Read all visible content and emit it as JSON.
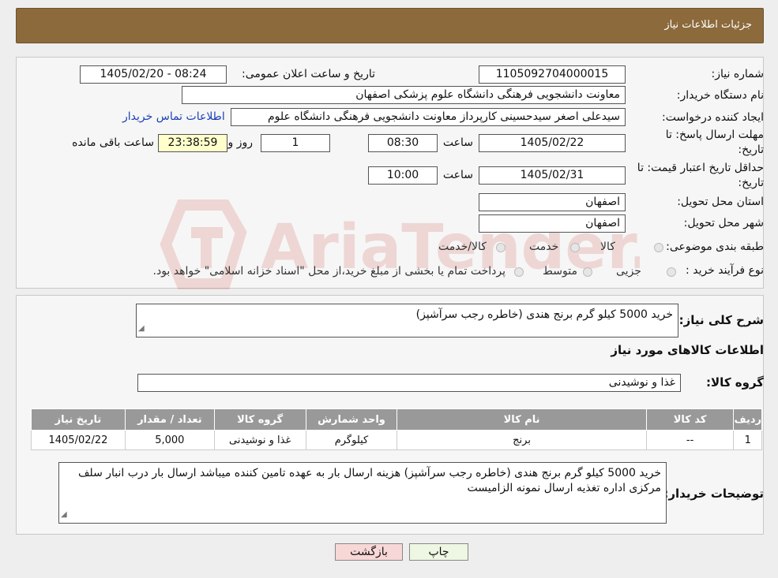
{
  "header": {
    "title": "جزئیات اطلاعات نیاز"
  },
  "fields": {
    "need_number_label": "شماره نیاز:",
    "need_number": "1105092704000015",
    "announce_label": "تاریخ و ساعت اعلان عمومی:",
    "announce_value": "1405/02/20 - 08:24",
    "buyer_org_label": "نام دستگاه خریدار:",
    "buyer_org": "معاونت دانشجویی فرهنگی دانشگاه علوم پزشکی اصفهان",
    "creator_label": "ایجاد کننده درخواست:",
    "creator": "سیدعلی اصغر سیدحسینی کارپرداز معاونت دانشجویی فرهنگی دانشگاه علوم",
    "contact_link": "اطلاعات تماس خریدار",
    "deadline_label_1": "مهلت ارسال پاسخ: تا",
    "deadline_label_2": "تاریخ:",
    "deadline_date": "1405/02/22",
    "time_label": "ساعت",
    "deadline_time": "08:30",
    "days": "1",
    "days_label": "روز و",
    "remaining": "23:38:59",
    "remaining_label": "ساعت باقی مانده",
    "validity_label_1": "حداقل تاریخ اعتبار قیمت: تا",
    "validity_label_2": "تاریخ:",
    "validity_date": "1405/02/31",
    "validity_time": "10:00",
    "province_label": "استان محل تحویل:",
    "province": "اصفهان",
    "city_label": "شهر محل تحویل:",
    "city": "اصفهان",
    "category_label": "طبقه بندی موضوعی:",
    "category_options": [
      "کالا",
      "خدمت",
      "کالا/خدمت"
    ],
    "process_label": "نوع فرآیند خرید :",
    "process_options": [
      "جزیی",
      "متوسط"
    ],
    "process_note": "پرداخت تمام یا بخشی از مبلغ خرید،از محل \"اسناد خزانه اسلامی\" خواهد بود."
  },
  "summary": {
    "label": "شرح کلی نیاز:",
    "text": "خرید 5000 کیلو گرم برنج هندی (خاطره رجب سرآشپز)",
    "goods_info_title": "اطلاعات کالاهای مورد نیاز",
    "group_label": "گروه کالا:",
    "group_value": "غذا و نوشیدنی"
  },
  "table": {
    "headers": [
      "ردیف",
      "کد کالا",
      "نام کالا",
      "واحد شمارش",
      "گروه کالا",
      "تعداد / مقدار",
      "تاریخ نیاز"
    ],
    "rows": [
      [
        "1",
        "--",
        "برنج",
        "کیلوگرم",
        "غذا و نوشیدنی",
        "5,000",
        "1405/02/22"
      ]
    ]
  },
  "buyer_notes": {
    "label": "توضیحات خریدار:",
    "text": "خرید 5000 کیلو گرم برنج هندی (خاطره رجب سرآشپز) هزینه ارسال بار به عهده تامین کننده میباشد ارسال بار درب انبار سلف مرکزی اداره تغذیه ارسال نمونه الزامیست"
  },
  "buttons": {
    "print": "چاپ",
    "back": "بازگشت"
  },
  "watermark": {
    "text": "AriaTender.neT"
  },
  "colors": {
    "header": "#8c6a3c",
    "link": "#1a3fb8",
    "back_button": "#f8d7d7",
    "print_button": "#eef7e4",
    "watermark": "#c0392b"
  }
}
